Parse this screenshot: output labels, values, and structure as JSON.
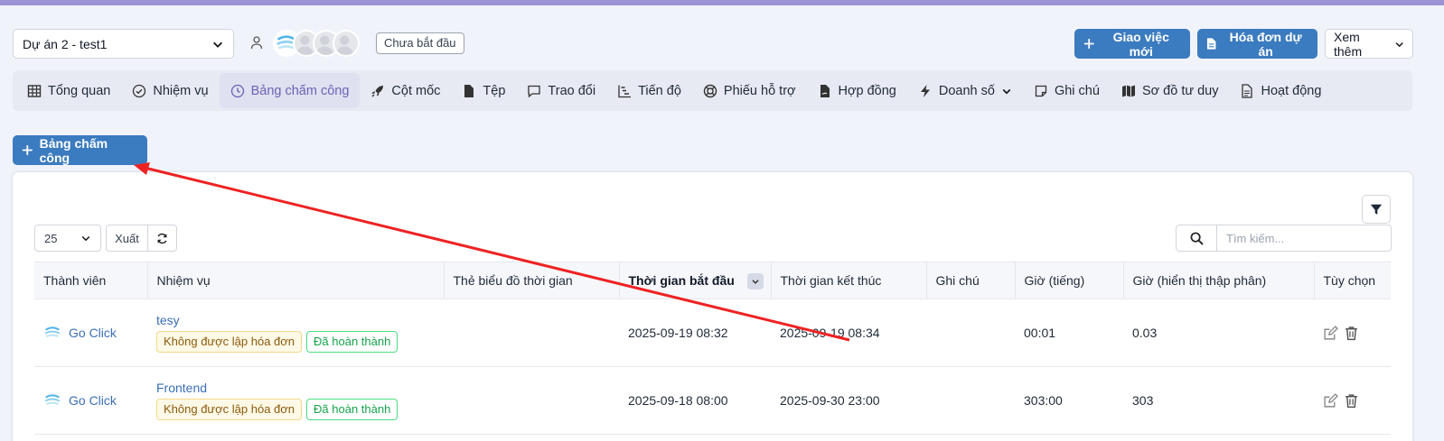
{
  "header": {
    "project_select": "Dự án 2 - test1",
    "status_tag": "Chưa bắt đầu",
    "btn_new_task": "Giao việc mới",
    "btn_invoice": "Hóa đơn dự án",
    "btn_more": "Xem thêm"
  },
  "tabs": [
    {
      "label": "Tổng quan",
      "icon": "grid-icon"
    },
    {
      "label": "Nhiệm vụ",
      "icon": "check-circle-icon"
    },
    {
      "label": "Bảng chấm công",
      "icon": "clock-icon",
      "active": true
    },
    {
      "label": "Cột mốc",
      "icon": "rocket-icon"
    },
    {
      "label": "Tệp",
      "icon": "file-icon"
    },
    {
      "label": "Trao đổi",
      "icon": "chat-icon"
    },
    {
      "label": "Tiến độ",
      "icon": "chart-icon"
    },
    {
      "label": "Phiếu hỗ trợ",
      "icon": "lifebuoy-icon"
    },
    {
      "label": "Hợp đồng",
      "icon": "contract-icon"
    },
    {
      "label": "Doanh số",
      "icon": "bolt-icon",
      "dropdown": true
    },
    {
      "label": "Ghi chú",
      "icon": "note-icon"
    },
    {
      "label": "Sơ đồ tư duy",
      "icon": "map-icon"
    },
    {
      "label": "Hoạt động",
      "icon": "doc-list-icon"
    }
  ],
  "toolbar": {
    "add_timesheet": "Bảng chấm công",
    "page_size": "25",
    "export": "Xuất",
    "search_placeholder": "Tìm kiếm..."
  },
  "table": {
    "columns": [
      "Thành viên",
      "Nhiệm vụ",
      "Thẻ biểu đồ thời gian",
      "Thời gian bắt đầu",
      "Thời gian kết thúc",
      "Ghi chú",
      "Giờ (tiếng)",
      "Giờ (hiển thị thập phân)",
      "Tùy chọn"
    ],
    "rows": [
      {
        "member": "Go Click",
        "task": "tesy",
        "badge_invoice": "Không được lập hóa đơn",
        "badge_status": "Đã hoàn thành",
        "tags": "",
        "start": "2025-09-19 08:32",
        "end": "2025-09-19 08:34",
        "note": "",
        "hours": "00:01",
        "decimal": "0.03"
      },
      {
        "member": "Go Click",
        "task": "Frontend",
        "badge_invoice": "Không được lập hóa đơn",
        "badge_status": "Đã hoàn thành",
        "tags": "",
        "start": "2025-09-18 08:00",
        "end": "2025-09-30 23:00",
        "note": "",
        "hours": "303:00",
        "decimal": "303"
      }
    ]
  },
  "colors": {
    "primary": "#3b7bbf",
    "active_tab": "#6b63b5",
    "annotation_arrow": "#ee2222"
  }
}
